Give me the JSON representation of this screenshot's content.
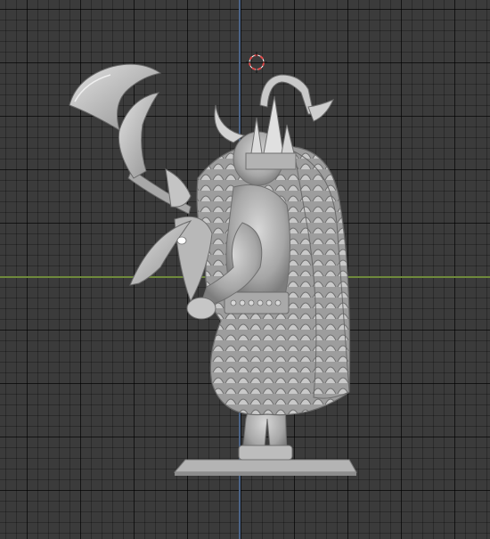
{
  "viewport": {
    "background_color": "#3b3b3b",
    "grid_color": "#2a2a2a",
    "x_axis_color": "#6f8a3c",
    "z_axis_color": "#4c6487"
  },
  "cursor": {
    "icon": "3d-cursor-icon",
    "ring_colors": [
      "#e24a4a",
      "#ffffff"
    ]
  },
  "model": {
    "description_icon": "barbarian-miniature-model",
    "material_color": "#b8b8b8"
  }
}
